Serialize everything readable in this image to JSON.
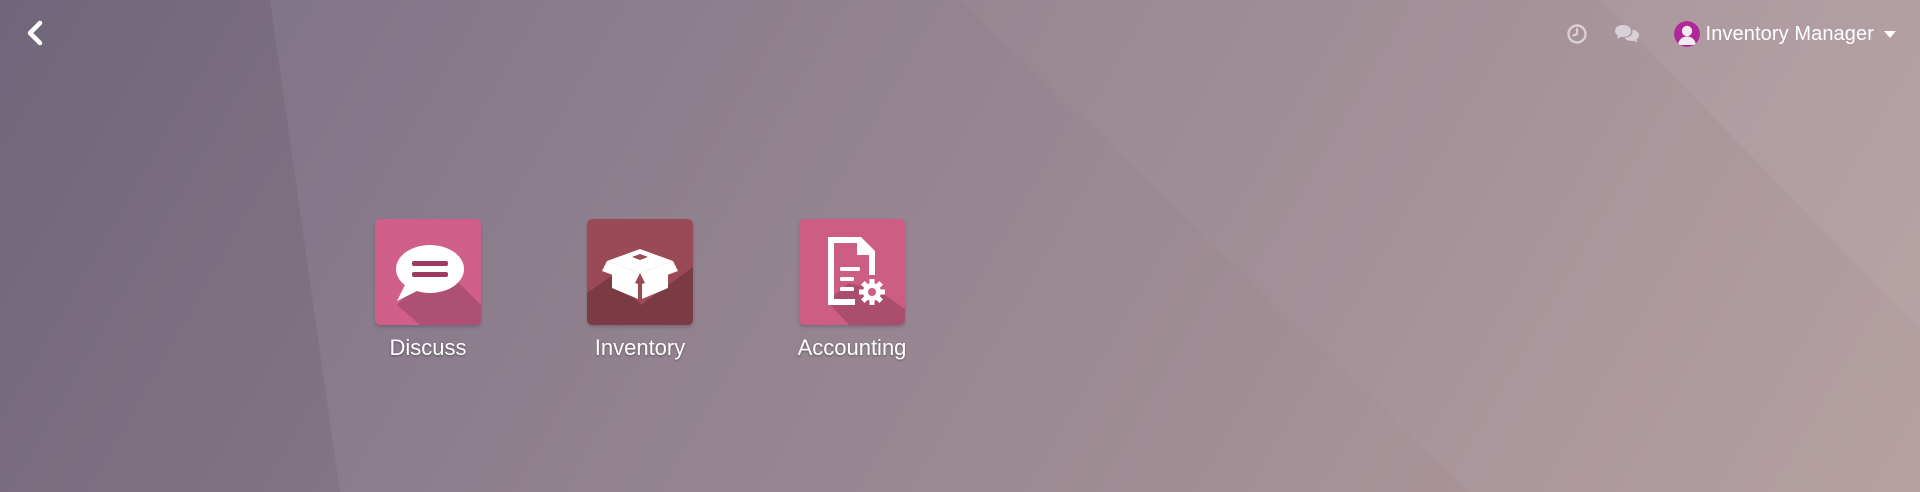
{
  "topbar": {
    "back_icon": "chevron-left-icon",
    "activity_icon": "clock-icon",
    "messages_icon": "chat-bubbles-icon",
    "user": {
      "name": "Inventory Manager",
      "avatar_icon": "user-avatar-icon"
    }
  },
  "apps": [
    {
      "label": "Discuss",
      "icon": "speech-bubble-icon",
      "color": "#d0608a"
    },
    {
      "label": "Inventory",
      "icon": "open-box-icon",
      "color": "#9a4a56"
    },
    {
      "label": "Accounting",
      "icon": "document-gear-icon",
      "color": "#cc5e84"
    }
  ],
  "colors": {
    "background_start": "#746a80",
    "background_end": "#b29a9c",
    "avatar": "#b0279a"
  }
}
